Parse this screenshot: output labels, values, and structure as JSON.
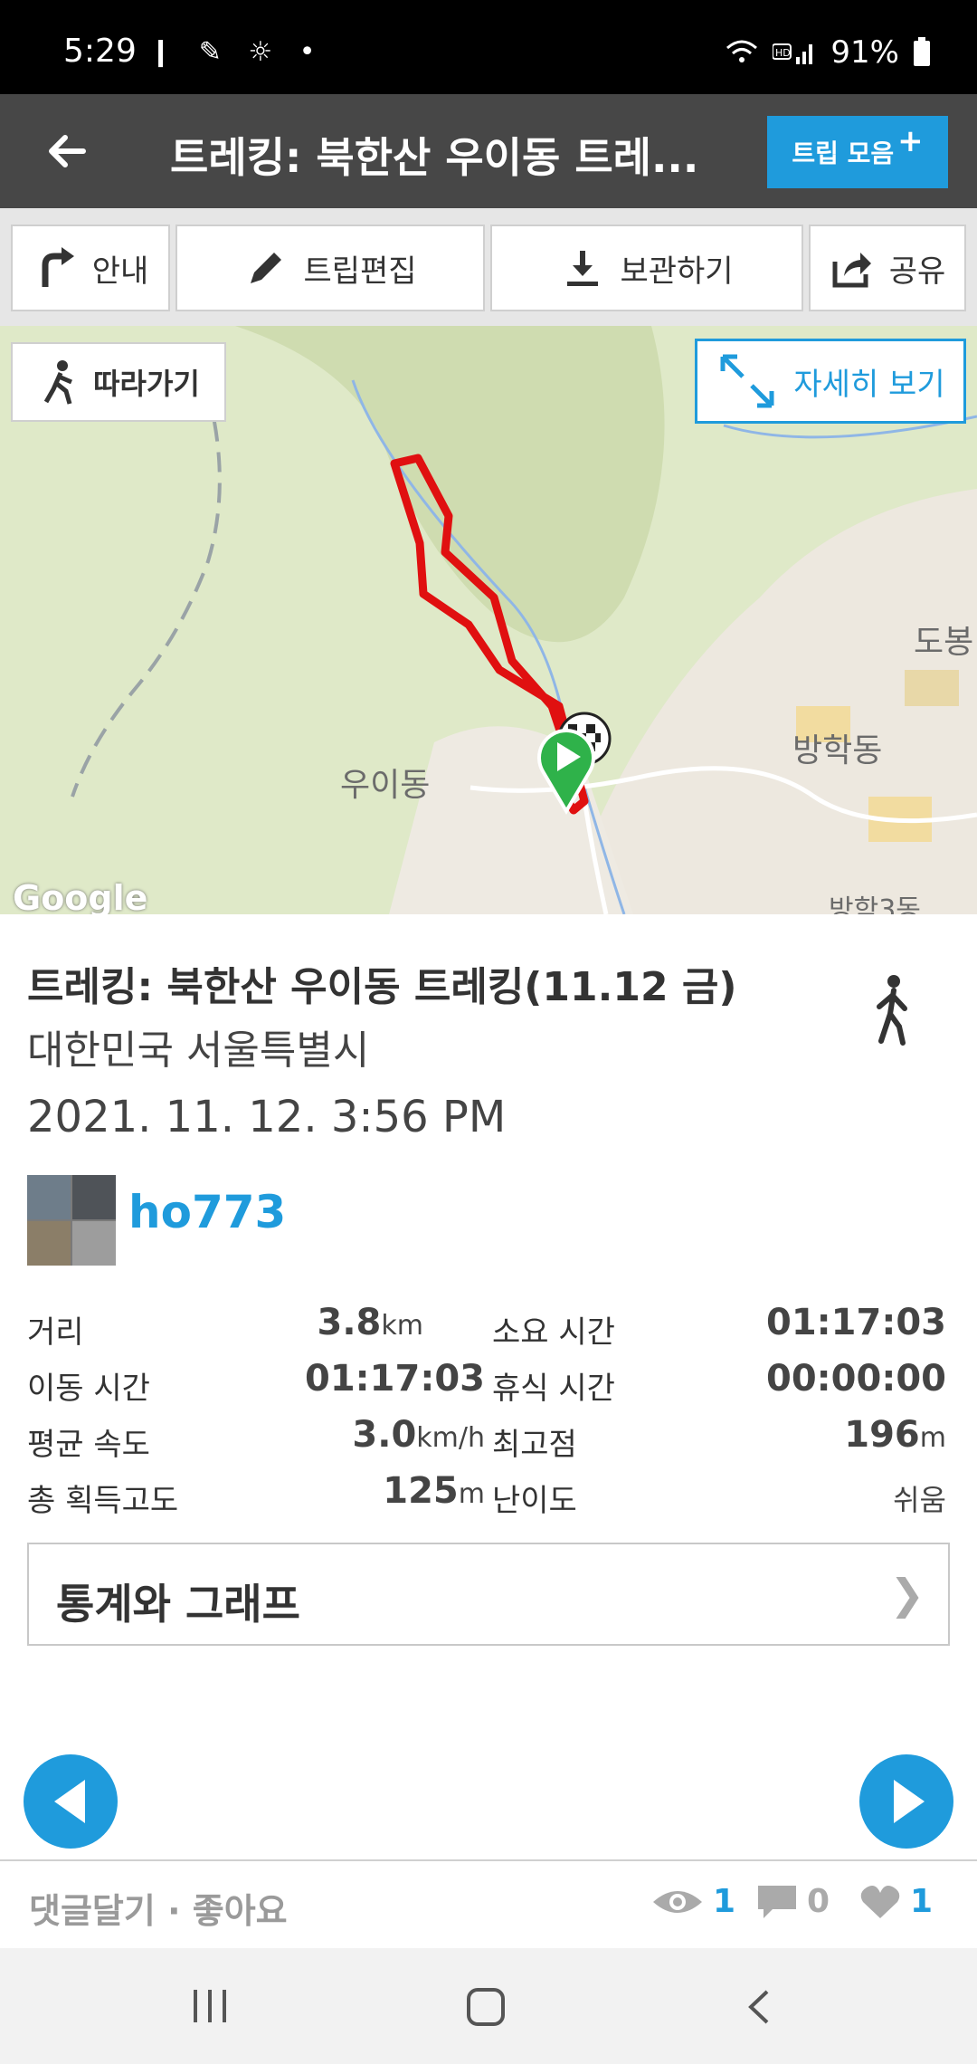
{
  "status_bar": {
    "time": "5:29",
    "battery": "91%"
  },
  "header": {
    "title": "트레킹: 북한산 우이동 트레...",
    "trip_button": "트립 모음"
  },
  "toolbar": {
    "guide": "안내",
    "edit": "트립편집",
    "save": "보관하기",
    "share": "공유"
  },
  "map": {
    "follow": "따라가기",
    "detail": "자세히 보기",
    "labels": {
      "uidong": "우이동",
      "banghak": "방학동",
      "dobong": "도봉",
      "banghak3": "방학3동"
    },
    "attribution": "Google",
    "route_color": "#e01010"
  },
  "trip": {
    "title": "트레킹: 북한산 우이동 트레킹(11.12  금)",
    "location": "대한민국 서울특별시",
    "datetime": "2021. 11. 12. 3:56 PM",
    "user": "ho773",
    "activity_icon": "walking-icon"
  },
  "stats": {
    "distance_label": "거리",
    "distance_value": "3.8",
    "distance_unit": "km",
    "elapsed_label": "소요 시간",
    "elapsed_value": "01:17:03",
    "moving_label": "이동 시간",
    "moving_value": "01:17:03",
    "rest_label": "휴식 시간",
    "rest_value": "00:00:00",
    "avg_speed_label": "평균 속도",
    "avg_speed_value": "3.0",
    "avg_speed_unit": "km/h",
    "max_alt_label": "최고점",
    "max_alt_value": "196",
    "max_alt_unit": "m",
    "gain_label": "총 획득고도",
    "gain_value": "125",
    "gain_unit": "m",
    "difficulty_label": "난이도",
    "difficulty_value": "쉬움"
  },
  "graph_button": "통계와 그래프",
  "bottom": {
    "comment_like": "댓글달기 · 좋아요",
    "views": "1",
    "comments": "0",
    "likes": "1"
  },
  "colors": {
    "accent": "#1f9bdc",
    "appbar": "#474747"
  }
}
